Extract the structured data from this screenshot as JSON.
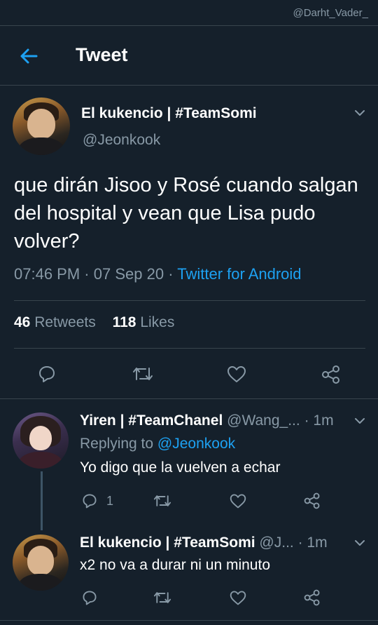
{
  "watermark": "@Darht_Vader_",
  "header": {
    "title": "Tweet"
  },
  "tweet": {
    "author_name": "El kukencio | #TeamSomi",
    "author_handle": "@Jeonkook",
    "text": "que dirán Jisoo y Rosé cuando salgan del hospital y vean que Lisa pudo volver?",
    "time": "07:46 PM",
    "date": "07 Sep 20",
    "source": "Twitter for Android",
    "retweets_count": "46",
    "retweets_label": "Retweets",
    "likes_count": "118",
    "likes_label": "Likes"
  },
  "replies": [
    {
      "name": "Yiren | #TeamChanel",
      "handle": "@Wang_...",
      "time": "· 1m",
      "replying_label": "Replying to",
      "replying_to": "@Jeonkook",
      "text": "Yo digo que la vuelven a echar",
      "reply_count": "1"
    },
    {
      "name": "El kukencio | #TeamSomi",
      "handle": "@J...",
      "time": "· 1m",
      "text": "x2 no va a durar ni un minuto"
    }
  ],
  "colors": {
    "background": "#15202b",
    "accent": "#1da1f2",
    "muted": "#8899a6",
    "divider": "#38444d"
  },
  "icons": [
    "back-arrow-icon",
    "chevron-down-icon",
    "reply-icon",
    "retweet-icon",
    "like-icon",
    "share-icon"
  ]
}
